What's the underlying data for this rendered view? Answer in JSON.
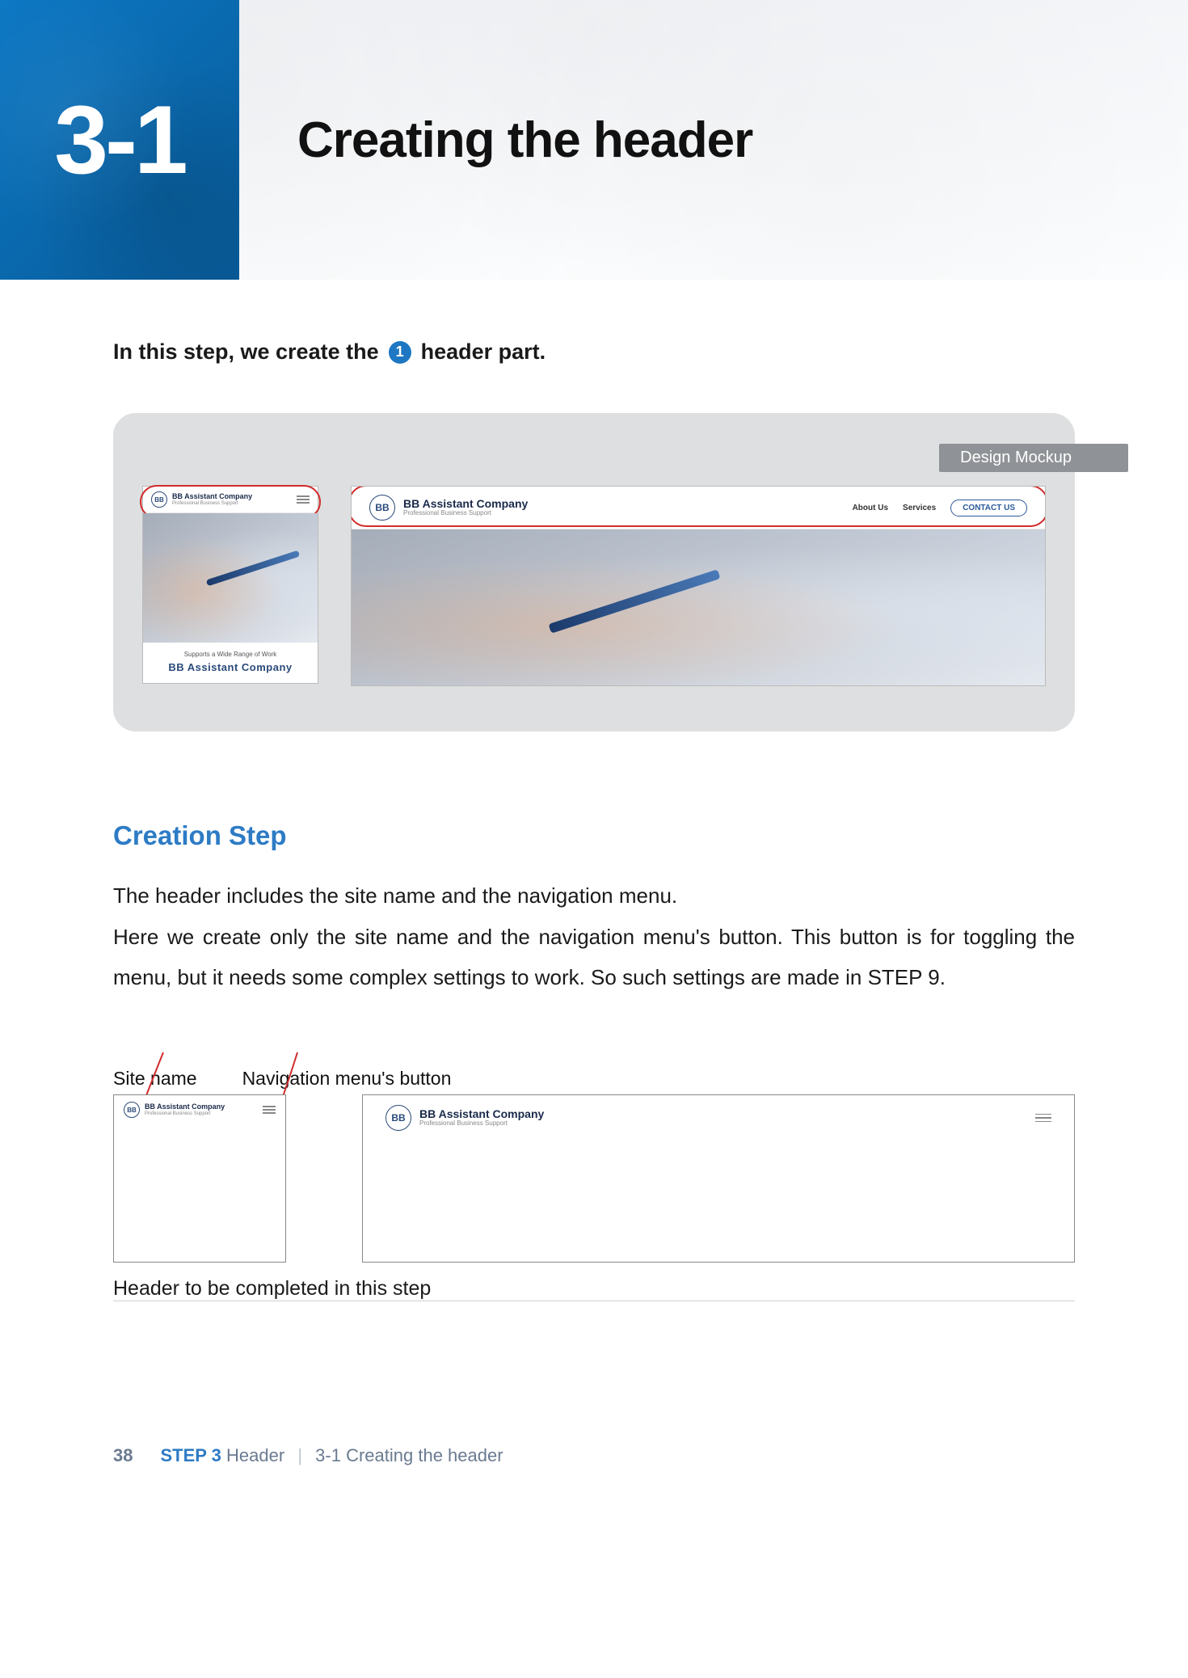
{
  "banner": {
    "number": "3-1",
    "title": "Creating the header"
  },
  "intro": {
    "before": "In this step, we create the",
    "circle": "1",
    "after": "header part."
  },
  "mockup": {
    "label": "Design Mockup",
    "logo_initials": "BB",
    "company": "BB Assistant Company",
    "subtitle": "Professional Business Support",
    "nav_about": "About Us",
    "nav_services": "Services",
    "nav_contact": "CONTACT US",
    "hero_small": "Supports a Wide Range of Work",
    "hero_big": "BB Assistant Company"
  },
  "section": {
    "title": "Creation Step",
    "p1": "The header includes the site name and the navigation menu.",
    "p2": "Here we create only the site name and the navigation menu's button. This button is for toggling the menu, but it needs some complex settings to work. So such settings are made in STEP 9."
  },
  "diagram": {
    "label_site": "Site name",
    "label_nav": "Navigation menu's button",
    "caption": "Header to be completed in this step"
  },
  "footer": {
    "page": "38",
    "step_label": "STEP 3",
    "step_name": "Header",
    "sep": "|",
    "crumb_num": "3-1",
    "crumb_title": "Creating the header"
  }
}
